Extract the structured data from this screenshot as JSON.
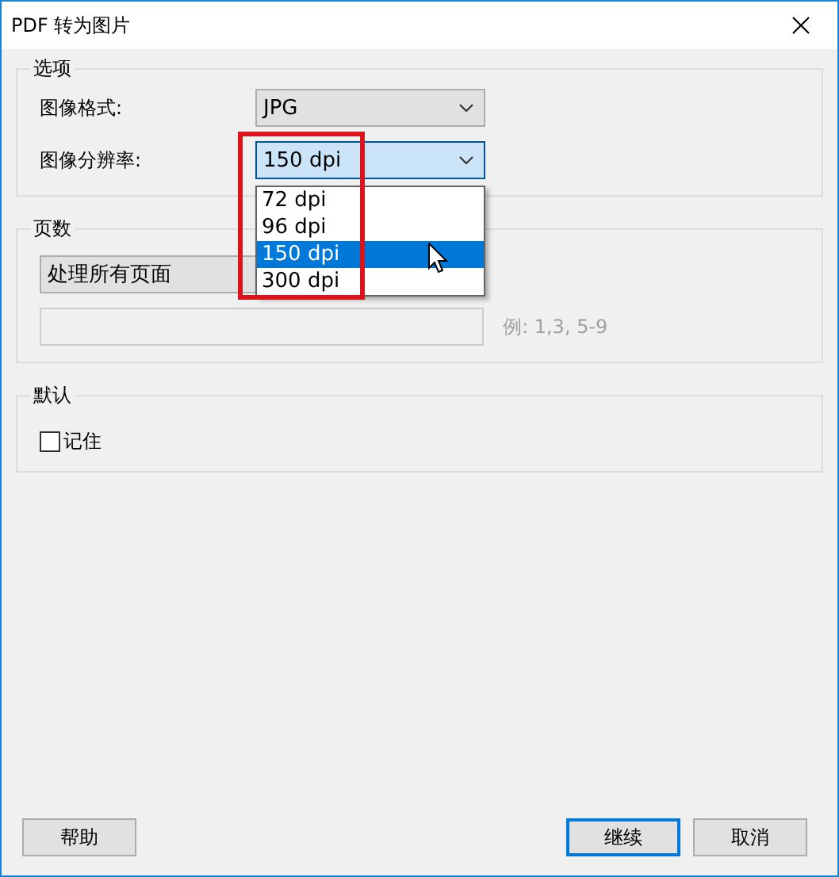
{
  "window": {
    "title": "PDF 转为图片"
  },
  "options": {
    "title": "选项",
    "rows": [
      {
        "label": "图像格式:",
        "value": "JPG",
        "focused": false
      },
      {
        "label": "图像分辨率:",
        "value": "150 dpi",
        "focused": true,
        "items": [
          {
            "label": "72 dpi",
            "selected": false
          },
          {
            "label": "96 dpi",
            "selected": false
          },
          {
            "label": "150 dpi",
            "selected": true
          },
          {
            "label": "300 dpi",
            "selected": false
          }
        ]
      }
    ]
  },
  "pages": {
    "title": "页数",
    "range_select": {
      "value": "处理所有页面"
    },
    "range_field": {
      "disabled": true
    },
    "hint": "例: 1,3, 5-9"
  },
  "defaults": {
    "title": "默认",
    "remember": {
      "label": "记住",
      "checked": false
    }
  },
  "buttons": [
    {
      "label": "帮助",
      "default": false
    },
    {
      "label": "继续",
      "default": true
    },
    {
      "label": "取消",
      "default": false
    }
  ]
}
